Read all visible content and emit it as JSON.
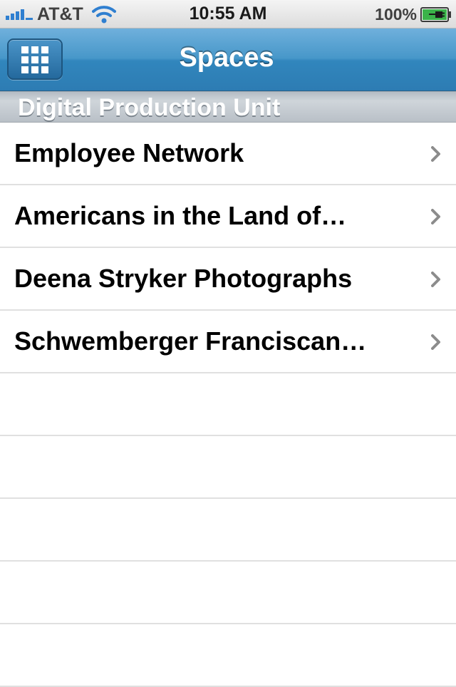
{
  "status_bar": {
    "carrier": "AT&T",
    "time": "10:55 AM",
    "battery_percent": "100%",
    "icons": [
      "signal-bars-icon",
      "wifi-icon",
      "battery-charging-icon"
    ]
  },
  "nav_bar": {
    "title": "Spaces",
    "left_button_icon": "grid-icon"
  },
  "section": {
    "title": "Digital Production Unit"
  },
  "list": {
    "items": [
      {
        "label": "Employee Network"
      },
      {
        "label": "Americans in the Land of…"
      },
      {
        "label": "Deena Stryker Photographs"
      },
      {
        "label": "Schwemberger Franciscan…"
      }
    ],
    "accessory_icon": "chevron-right-icon"
  },
  "colors": {
    "nav_bar": "#3186bd",
    "section_header": "#c4cbd1",
    "separator": "#e0e0e0",
    "chevron": "#8c8c8c"
  }
}
